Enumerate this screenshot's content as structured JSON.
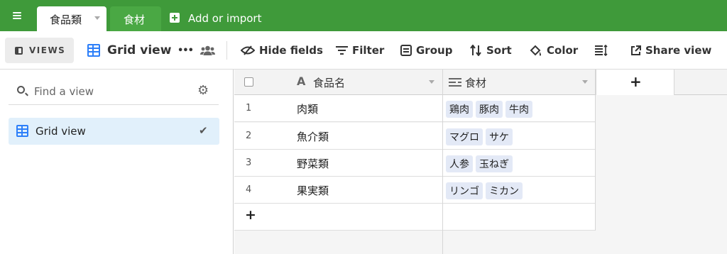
{
  "topbar": {
    "tabs": [
      {
        "label": "食品類",
        "active": true
      },
      {
        "label": "食材",
        "active": false
      }
    ],
    "add_import_label": "Add or import"
  },
  "toolbar": {
    "views_label": "VIEWS",
    "view_name": "Grid view",
    "more_label": "•••",
    "hide_fields_label": "Hide fields",
    "filter_label": "Filter",
    "group_label": "Group",
    "sort_label": "Sort",
    "color_label": "Color",
    "share_label": "Share view"
  },
  "sidebar": {
    "search_placeholder": "Find a view",
    "views": [
      {
        "label": "Grid view",
        "selected": true
      }
    ]
  },
  "grid": {
    "columns": [
      {
        "label": "食品名",
        "icon": "text-field-icon"
      },
      {
        "label": "食材",
        "icon": "multiselect-field-icon"
      }
    ],
    "add_column_label": "+",
    "add_row_label": "+",
    "rows": [
      {
        "num": "1",
        "name": "肉類",
        "tags": [
          "鶏肉",
          "豚肉",
          "牛肉"
        ]
      },
      {
        "num": "2",
        "name": "魚介類",
        "tags": [
          "マグロ",
          "サケ"
        ]
      },
      {
        "num": "3",
        "name": "野菜類",
        "tags": [
          "人参",
          "玉ねぎ"
        ]
      },
      {
        "num": "4",
        "name": "果実類",
        "tags": [
          "リンゴ",
          "ミカン"
        ]
      }
    ]
  },
  "colors": {
    "topbar": "#3f9a3a",
    "accent_blue": "#2d7ff9",
    "chip": "#e3e9f6",
    "selected_view": "#e1f0fb"
  }
}
